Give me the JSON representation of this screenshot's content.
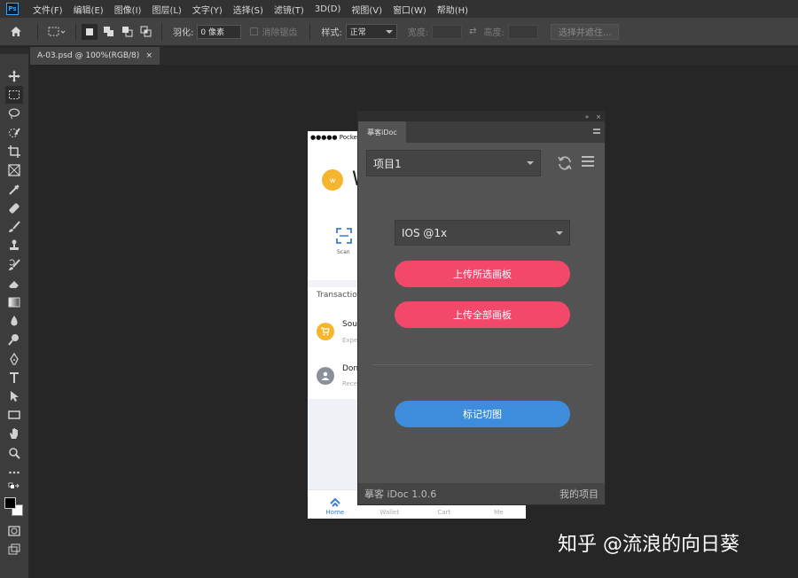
{
  "menubar": {
    "items": [
      "文件(F)",
      "编辑(E)",
      "图像(I)",
      "图层(L)",
      "文字(Y)",
      "选择(S)",
      "滤镜(T)",
      "3D(D)",
      "视图(V)",
      "窗口(W)",
      "帮助(H)"
    ]
  },
  "options": {
    "feather_label": "羽化:",
    "feather_value": "0 像素",
    "antialias_label": "消除锯齿",
    "style_label": "样式:",
    "style_value": "正常",
    "width_label": "宽度:",
    "height_label": "高度:",
    "select_mask_label": "选择并遮住..."
  },
  "document": {
    "tab_title": "A-03.psd @ 100%(RGB/8)",
    "close_glyph": "×"
  },
  "phone": {
    "status": "●●●●● Pocket",
    "avatar_letter": "w",
    "greeting_initial": "W",
    "scan_label": "Scan",
    "transactions_title": "Transaction",
    "rows": [
      {
        "title": "Sou",
        "sub": "Expe"
      },
      {
        "title": "Don",
        "sub": "Rece"
      }
    ],
    "tabs": [
      "Home",
      "Wallet",
      "Cart",
      "Me"
    ]
  },
  "panel": {
    "tab_label": "摹客iDoc",
    "project_value": "项目1",
    "scale_value": "IOS @1x",
    "upload_selected_label": "上传所选画板",
    "upload_all_label": "上传全部画板",
    "mark_slices_label": "标记切图",
    "footer_version": "摹客 iDoc 1.0.6",
    "footer_link": "我的项目",
    "titlebar_collapse": "»",
    "titlebar_close": "×"
  },
  "watermark": "知乎 @流浪的向日葵",
  "colors": {
    "pink": "#f2496b",
    "blue": "#3e8ddd",
    "avatar": "#f5b52e"
  }
}
